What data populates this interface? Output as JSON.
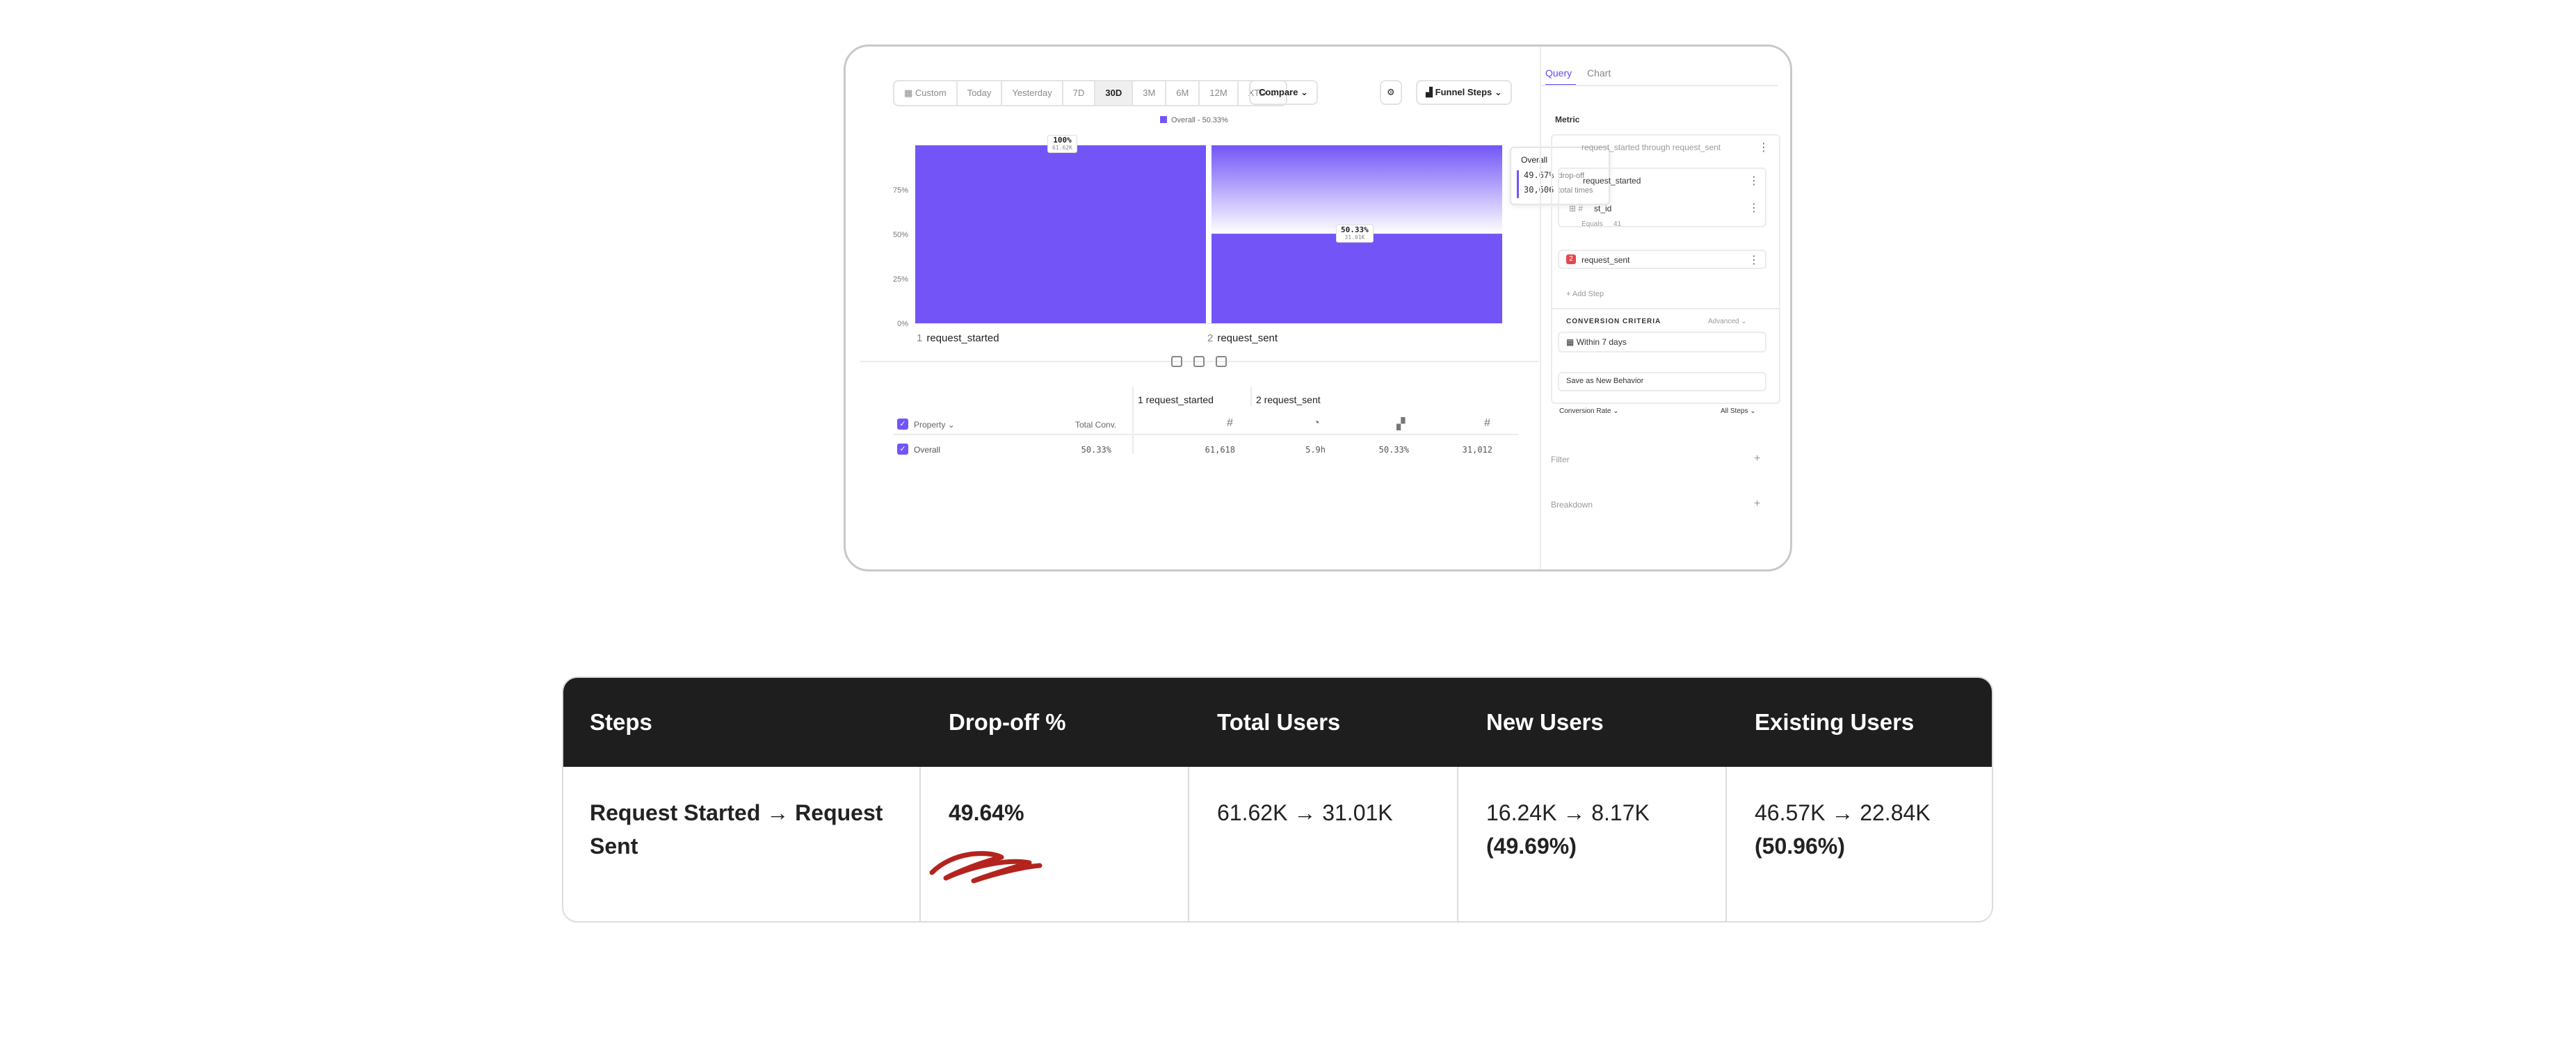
{
  "toolbar": {
    "date_ranges": [
      "Custom",
      "Today",
      "Yesterday",
      "7D",
      "30D",
      "3M",
      "6M",
      "12M",
      "XTD"
    ],
    "selected_range": "30D",
    "compare_label": "Compare",
    "chart_type_label": "Funnel Steps"
  },
  "chart": {
    "legend": "Overall - 50.33%",
    "y_ticks": [
      "0%",
      "25%",
      "50%",
      "75%"
    ],
    "bars": [
      {
        "index": "1",
        "name": "request_started",
        "pct": "100%",
        "count": "61.62K"
      },
      {
        "index": "2",
        "name": "request_sent",
        "pct": "50.33%",
        "count": "31.01K"
      }
    ],
    "tooltip": {
      "title": "Overall",
      "dropoff_value": "49.67%",
      "dropoff_label": "drop-off",
      "total_value": "30,606",
      "total_label": "total times"
    }
  },
  "chart_data": {
    "type": "bar",
    "categories": [
      "request_started",
      "request_sent"
    ],
    "values": [
      100,
      50.33
    ],
    "ylim": [
      0,
      100
    ]
  },
  "table": {
    "property_header": "Property",
    "total_conv_header": "Total Conv.",
    "step_headers": [
      "1 request_started",
      "2 request_sent"
    ],
    "row": {
      "label": "Overall",
      "total_conv": "50.33%",
      "step1_count": "61,618",
      "step2_time": "5.9h",
      "step2_pct": "50.33%",
      "step2_count": "31,012"
    }
  },
  "side": {
    "tabs": [
      "Query",
      "Chart"
    ],
    "metric_label": "Metric",
    "metric_title": "request_started through request_sent",
    "step1": "request_started",
    "filter_prop": "st_id",
    "filter_op": "Equals",
    "filter_val": "41",
    "step2": "request_sent",
    "add_step": "+ Add Step",
    "conversion_criteria": "CONVERSION CRITERIA",
    "advanced": "Advanced",
    "within": "Within 7 days",
    "save_behavior": "Save as New Behavior",
    "conversion_rate": "Conversion Rate",
    "all_steps": "All Steps",
    "filter": "Filter",
    "breakdown": "Breakdown"
  },
  "summary": {
    "headers": [
      "Steps",
      "Drop-off %",
      "Total Users",
      "New Users",
      "Existing Users"
    ],
    "steps": "Request Started → Request Sent",
    "dropoff": "49.64%",
    "total_users": "61.62K → 31.01K",
    "new_users": "16.24K → 8.17K",
    "new_users_pct": "(49.69%)",
    "existing_users": "46.57K → 22.84K",
    "existing_users_pct": "(50.96%)"
  }
}
